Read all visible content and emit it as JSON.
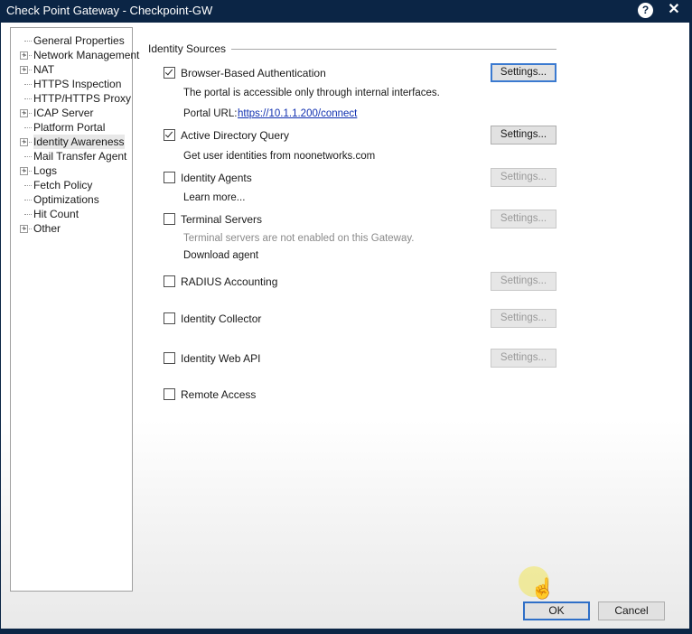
{
  "window": {
    "title": "Check Point Gateway - Checkpoint-GW",
    "help_label": "?",
    "close_label": "✕"
  },
  "tree": [
    {
      "label": "General Properties",
      "expandable": false
    },
    {
      "label": "Network Management",
      "expandable": true
    },
    {
      "label": "NAT",
      "expandable": true
    },
    {
      "label": "HTTPS Inspection",
      "expandable": false
    },
    {
      "label": "HTTP/HTTPS Proxy",
      "expandable": false
    },
    {
      "label": "ICAP Server",
      "expandable": true
    },
    {
      "label": "Platform Portal",
      "expandable": false
    },
    {
      "label": "Identity Awareness",
      "expandable": true,
      "selected": true
    },
    {
      "label": "Mail Transfer Agent",
      "expandable": false
    },
    {
      "label": "Logs",
      "expandable": true
    },
    {
      "label": "Fetch Policy",
      "expandable": false
    },
    {
      "label": "Optimizations",
      "expandable": false
    },
    {
      "label": "Hit Count",
      "expandable": false
    },
    {
      "label": "Other",
      "expandable": true
    }
  ],
  "identity_sources": {
    "title": "Identity Sources",
    "browser_auth": {
      "label": "Browser-Based Authentication",
      "checked": true,
      "note": "The portal is accessible only through internal interfaces.",
      "portal_url_label": "Portal URL:",
      "portal_url": "https://10.1.1.200/connect",
      "settings_label": "Settings..."
    },
    "ad_query": {
      "label": "Active Directory Query",
      "checked": true,
      "note": "Get user identities from noonetworks.com",
      "settings_label": "Settings..."
    },
    "identity_agents": {
      "label": "Identity Agents",
      "checked": false,
      "note": "Learn more...",
      "settings_label": "Settings..."
    },
    "terminal_servers": {
      "label": "Terminal Servers",
      "checked": false,
      "note": "Terminal servers are not enabled on this Gateway.",
      "download_label": "Download agent",
      "settings_label": "Settings..."
    },
    "radius": {
      "label": "RADIUS Accounting",
      "checked": false,
      "settings_label": "Settings..."
    },
    "identity_collector": {
      "label": "Identity Collector",
      "checked": false,
      "settings_label": "Settings..."
    },
    "web_api": {
      "label": "Identity Web API",
      "checked": false,
      "settings_label": "Settings..."
    },
    "remote_access": {
      "label": "Remote Access",
      "checked": false
    }
  },
  "buttons": {
    "ok_label": "OK",
    "cancel_label": "Cancel"
  },
  "colors": {
    "title_bar": "#0b2545",
    "focus_border": "#3b7ad0",
    "link": "#1030b0"
  }
}
